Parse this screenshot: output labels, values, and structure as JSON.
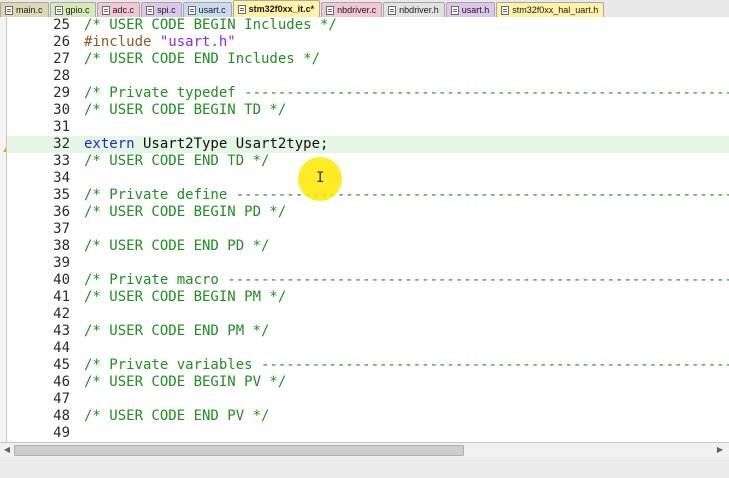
{
  "tabs": [
    {
      "label": "main.c",
      "color": "#dcd8b2",
      "active": false
    },
    {
      "label": "gpio.c",
      "color": "#d6e9b6",
      "active": false
    },
    {
      "label": "adc.c",
      "color": "#f2c6d4",
      "active": false
    },
    {
      "label": "spi.c",
      "color": "#dcc6ec",
      "active": false
    },
    {
      "label": "usart.c",
      "color": "#c9dcef",
      "active": false
    },
    {
      "label": "stm32f0xx_it.c*",
      "color": "#fff1a8",
      "active": true
    },
    {
      "label": "nbdriver.c",
      "color": "#f2c6d4",
      "active": false
    },
    {
      "label": "nbdriver.h",
      "color": "#e2e2e2",
      "active": false
    },
    {
      "label": "usart.h",
      "color": "#dcc6ec",
      "active": false
    },
    {
      "label": "stm32f0xx_hal_uart.h",
      "color": "#fff1a8",
      "active": false
    }
  ],
  "colors": {
    "comment": "#1f8f1f",
    "preprocessor": "#8a5a22",
    "string": "#8a2be2",
    "keyword": "#1a2bd6",
    "highlight_line": "#e6f6e6",
    "warning": "#e0b000",
    "cursor_highlight": "#ffe800"
  },
  "lines": [
    {
      "num": "25",
      "segments": [
        {
          "t": "/* USER CODE BEGIN Includes */",
          "c": "cm"
        }
      ]
    },
    {
      "num": "26",
      "segments": [
        {
          "t": "#include ",
          "c": "pp"
        },
        {
          "t": "\"usart.h\"",
          "c": "str"
        }
      ]
    },
    {
      "num": "27",
      "segments": [
        {
          "t": "/* USER CODE END Includes */",
          "c": "cm"
        }
      ]
    },
    {
      "num": "28",
      "segments": []
    },
    {
      "num": "29",
      "segments": [
        {
          "t": "/* Private typedef -----------------------------------------------------------",
          "c": "cm"
        }
      ]
    },
    {
      "num": "30",
      "segments": [
        {
          "t": "/* USER CODE BEGIN TD */",
          "c": "cm"
        }
      ]
    },
    {
      "num": "31",
      "segments": []
    },
    {
      "num": "32",
      "highlight": true,
      "warning": true,
      "segments": [
        {
          "t": "extern",
          "c": "kw"
        },
        {
          "t": " Usart2Type Usart2type;",
          "c": "tx"
        }
      ]
    },
    {
      "num": "33",
      "segments": [
        {
          "t": "/* USER CODE END TD */",
          "c": "cm"
        }
      ]
    },
    {
      "num": "34",
      "segments": []
    },
    {
      "num": "35",
      "segments": [
        {
          "t": "/* Private define ------------------------------------------------------------",
          "c": "cm"
        }
      ]
    },
    {
      "num": "36",
      "segments": [
        {
          "t": "/* USER CODE BEGIN PD */",
          "c": "cm"
        }
      ]
    },
    {
      "num": "37",
      "segments": []
    },
    {
      "num": "38",
      "segments": [
        {
          "t": "/* USER CODE END PD */",
          "c": "cm"
        }
      ]
    },
    {
      "num": "39",
      "segments": []
    },
    {
      "num": "40",
      "segments": [
        {
          "t": "/* Private macro -------------------------------------------------------------",
          "c": "cm"
        }
      ]
    },
    {
      "num": "41",
      "segments": [
        {
          "t": "/* USER CODE BEGIN PM */",
          "c": "cm"
        }
      ]
    },
    {
      "num": "42",
      "segments": []
    },
    {
      "num": "43",
      "segments": [
        {
          "t": "/* USER CODE END PM */",
          "c": "cm"
        }
      ]
    },
    {
      "num": "44",
      "segments": []
    },
    {
      "num": "45",
      "segments": [
        {
          "t": "/* Private variables ---------------------------------------------------------",
          "c": "cm"
        }
      ]
    },
    {
      "num": "46",
      "segments": [
        {
          "t": "/* USER CODE BEGIN PV */",
          "c": "cm"
        }
      ]
    },
    {
      "num": "47",
      "segments": []
    },
    {
      "num": "48",
      "segments": [
        {
          "t": "/* USER CODE END PV */",
          "c": "cm"
        }
      ]
    },
    {
      "num": "49",
      "segments": []
    }
  ],
  "icons": {
    "tab": "file-icon",
    "warning": "warning-icon",
    "cursor": "text-cursor-icon"
  },
  "cursor_glyph": "I"
}
